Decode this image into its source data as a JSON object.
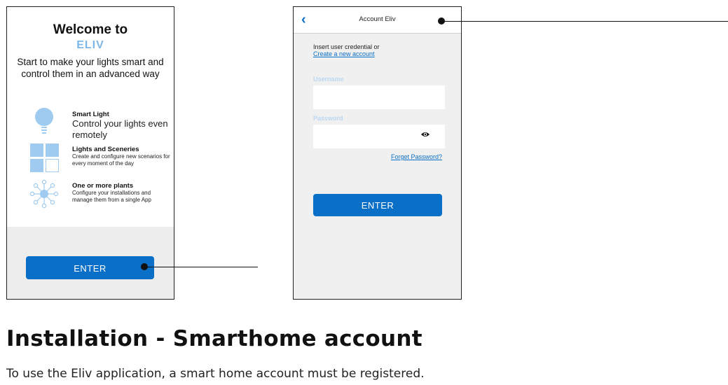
{
  "welcome_screen": {
    "title": "Welcome to",
    "brand": "ELIV",
    "intro": "Start to make your lights smart and control them in an advanced way",
    "features": [
      {
        "title": "Smart Light",
        "description": "Control your lights even remotely",
        "icon": "lightbulb-icon"
      },
      {
        "title": "Lights and Sceneries",
        "description": "Create and configure new scenarios for every moment of the day",
        "icon": "tiles-icon"
      },
      {
        "title": "One or more plants",
        "description": "Configure your installations and manage them from a single App",
        "icon": "network-icon"
      }
    ],
    "enter_label": "ENTER"
  },
  "account_screen": {
    "header_title": "Account Eliv",
    "insert_text": "Insert user credential or",
    "create_link": "Create a new account",
    "username_label": "Username",
    "username_value": "",
    "password_label": "Password",
    "password_value": "",
    "forget_link": "Forget Password?",
    "enter_label": "ENTER"
  },
  "doc": {
    "heading": "Installation - Smarthome account",
    "paragraph": "To use the Eliv application, a smart home account must be registered."
  },
  "colors": {
    "accent_blue": "#0a6fc6",
    "brand_light_blue": "#7db7e8",
    "icon_blue": "#9fcbf0",
    "panel_gray": "#ededed"
  }
}
